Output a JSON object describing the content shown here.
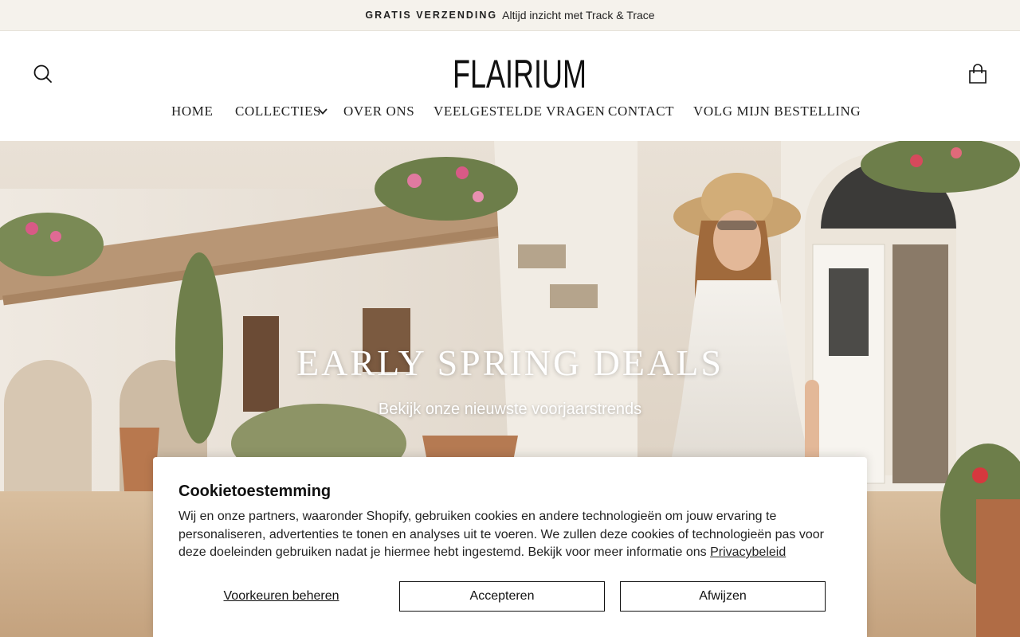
{
  "announcement": {
    "highlight": "GRATIS VERZENDING",
    "text": "Altijd inzicht met Track & Trace"
  },
  "header": {
    "logo": "FLAIRIUM",
    "search_icon": "search-icon",
    "cart_icon": "shopping-bag-icon"
  },
  "nav": {
    "items": [
      {
        "label": "HOME"
      },
      {
        "label": "COLLECTIES",
        "icon": "chevron-down-icon"
      },
      {
        "label": "OVER ONS"
      },
      {
        "label": "VEELGESTELDE VRAGEN"
      },
      {
        "label": "CONTACT"
      },
      {
        "label": "VOLG MIJN BESTELLING"
      }
    ]
  },
  "hero": {
    "title": "EARLY SPRING DEALS",
    "subtitle": "Bekijk onze nieuwste voorjaarstrends"
  },
  "cookie": {
    "title": "Cookietoestemming",
    "text": "Wij en onze partners, waaronder Shopify, gebruiken cookies en andere technologieën om jouw ervaring te personaliseren, advertenties te tonen en analyses uit te voeren. We zullen deze cookies of technologieën pas voor deze doeleinden gebruiken nadat je hiermee hebt ingestemd. Bekijk voor meer informatie ons",
    "link": "Privacybeleid",
    "manage_label": "Voorkeuren beheren",
    "accept_label": "Accepteren",
    "decline_label": "Afwijzen"
  },
  "colors": {
    "announcement_bg": "#f5f2ec",
    "text": "#111111",
    "banner_bg": "#ffffff"
  }
}
